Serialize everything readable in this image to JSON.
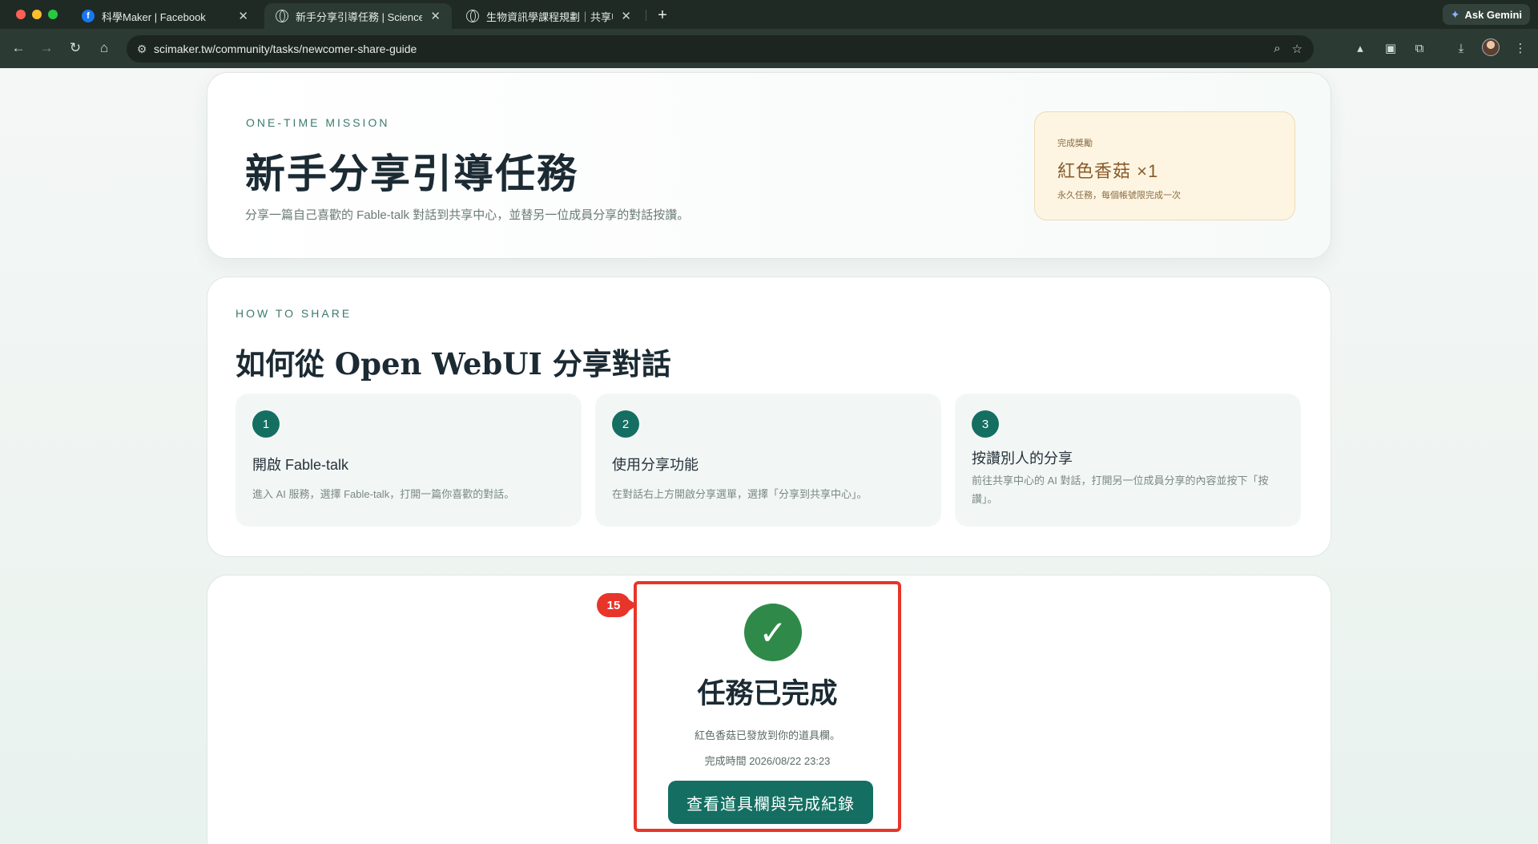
{
  "browser": {
    "tabs": [
      {
        "title": "科學Maker | Facebook",
        "icon": "facebook-icon"
      },
      {
        "title": "新手分享引導任務 | Science M",
        "icon": "globe-icon"
      },
      {
        "title": "生物資訊學課程規劃｜共享中心",
        "icon": "globe-icon"
      }
    ],
    "new_tab": "+",
    "gemini_label": "Ask Gemini",
    "url": "scimaker.tw/community/tasks/newcomer-share-guide"
  },
  "hero": {
    "eyebrow": "ONE-TIME MISSION",
    "title": "新手分享引導任務",
    "subtitle": "分享一篇自己喜歡的 Fable-talk 對話到共享中心，並替另一位成員分享的對話按讚。",
    "reward": {
      "label": "完成獎勵",
      "value": "紅色香菇 ×1",
      "note": "永久任務，每個帳號限完成一次"
    }
  },
  "howto": {
    "eyebrow": "HOW TO SHARE",
    "title": "如何從 Open WebUI 分享對話",
    "steps": [
      {
        "num": "1",
        "title": "開啟 Fable-talk",
        "desc": "進入 AI 服務，選擇 Fable-talk，打開一篇你喜歡的對話。"
      },
      {
        "num": "2",
        "title": "使用分享功能",
        "desc": "在對話右上方開啟分享選單，選擇「分享到共享中心」。"
      },
      {
        "num": "3",
        "title": "按讚別人的分享",
        "desc": "前往共享中心的 AI 對話，打開另一位成員分享的內容並按下「按讚」。"
      }
    ]
  },
  "completion": {
    "annotation": "15",
    "title": "任務已完成",
    "message": "紅色香菇已發放到你的道具欄。",
    "time": "完成時間 2026/08/22 23:23",
    "button": "查看道具欄與完成紀錄"
  },
  "colors": {
    "accent": "#146f62",
    "success": "#2f8a4a",
    "highlight": "#e8352a",
    "reward_bg": "#fdf5e2"
  }
}
